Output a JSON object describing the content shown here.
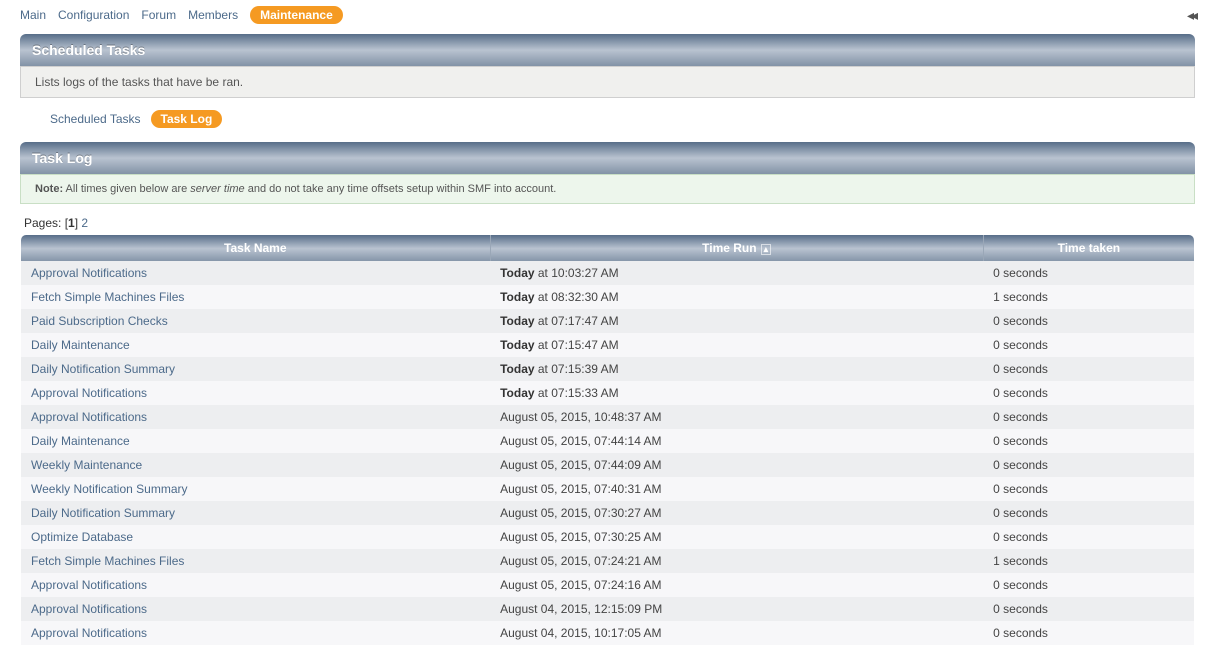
{
  "topmenu": {
    "items": [
      {
        "label": "Main",
        "active": false
      },
      {
        "label": "Configuration",
        "active": false
      },
      {
        "label": "Forum",
        "active": false
      },
      {
        "label": "Members",
        "active": false
      },
      {
        "label": "Maintenance",
        "active": true
      }
    ]
  },
  "section1": {
    "title": "Scheduled Tasks",
    "description": "Lists logs of the tasks that have be ran."
  },
  "subtabs": {
    "items": [
      {
        "label": "Scheduled Tasks",
        "active": false
      },
      {
        "label": "Task Log",
        "active": true
      }
    ]
  },
  "section2": {
    "title": "Task Log"
  },
  "note": {
    "prefix": "Note:",
    "part1": " All times given below are ",
    "em": "server time",
    "part2": " and do not take any time offsets setup within SMF into account."
  },
  "pagination": {
    "label": "Pages: ",
    "open": "[",
    "current": "1",
    "close": "]",
    "other": "2"
  },
  "table": {
    "columns": [
      "Task Name",
      "Time Run",
      "Time taken"
    ],
    "sort_col_index": 1,
    "sort_dir": "asc",
    "rows": [
      {
        "name": "Approval Notifications",
        "time_prefix": "Today",
        "time_rest": " at 10:03:27 AM",
        "taken": "0 seconds"
      },
      {
        "name": "Fetch Simple Machines Files",
        "time_prefix": "Today",
        "time_rest": " at 08:32:30 AM",
        "taken": "1 seconds"
      },
      {
        "name": "Paid Subscription Checks",
        "time_prefix": "Today",
        "time_rest": " at 07:17:47 AM",
        "taken": "0 seconds"
      },
      {
        "name": "Daily Maintenance",
        "time_prefix": "Today",
        "time_rest": " at 07:15:47 AM",
        "taken": "0 seconds"
      },
      {
        "name": "Daily Notification Summary",
        "time_prefix": "Today",
        "time_rest": " at 07:15:39 AM",
        "taken": "0 seconds"
      },
      {
        "name": "Approval Notifications",
        "time_prefix": "Today",
        "time_rest": " at 07:15:33 AM",
        "taken": "0 seconds"
      },
      {
        "name": "Approval Notifications",
        "time_prefix": "",
        "time_rest": "August 05, 2015, 10:48:37 AM",
        "taken": "0 seconds"
      },
      {
        "name": "Daily Maintenance",
        "time_prefix": "",
        "time_rest": "August 05, 2015, 07:44:14 AM",
        "taken": "0 seconds"
      },
      {
        "name": "Weekly Maintenance",
        "time_prefix": "",
        "time_rest": "August 05, 2015, 07:44:09 AM",
        "taken": "0 seconds"
      },
      {
        "name": "Weekly Notification Summary",
        "time_prefix": "",
        "time_rest": "August 05, 2015, 07:40:31 AM",
        "taken": "0 seconds"
      },
      {
        "name": "Daily Notification Summary",
        "time_prefix": "",
        "time_rest": "August 05, 2015, 07:30:27 AM",
        "taken": "0 seconds"
      },
      {
        "name": "Optimize Database",
        "time_prefix": "",
        "time_rest": "August 05, 2015, 07:30:25 AM",
        "taken": "0 seconds"
      },
      {
        "name": "Fetch Simple Machines Files",
        "time_prefix": "",
        "time_rest": "August 05, 2015, 07:24:21 AM",
        "taken": "1 seconds"
      },
      {
        "name": "Approval Notifications",
        "time_prefix": "",
        "time_rest": "August 05, 2015, 07:24:16 AM",
        "taken": "0 seconds"
      },
      {
        "name": "Approval Notifications",
        "time_prefix": "",
        "time_rest": "August 04, 2015, 12:15:09 PM",
        "taken": "0 seconds"
      },
      {
        "name": "Approval Notifications",
        "time_prefix": "",
        "time_rest": "August 04, 2015, 10:17:05 AM",
        "taken": "0 seconds"
      }
    ]
  }
}
